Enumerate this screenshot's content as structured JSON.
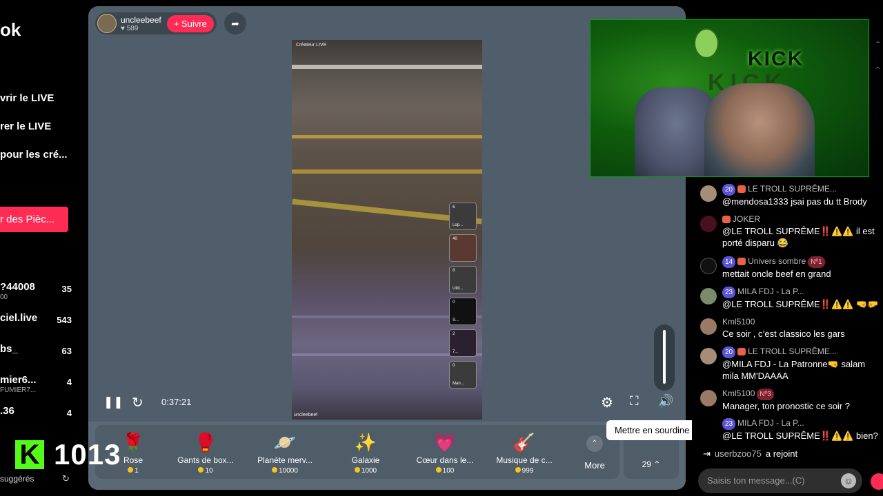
{
  "sidebar": {
    "logo": "ok",
    "menu": [
      "vrir le LIVE",
      "rer le LIVE",
      "pour les cré..."
    ],
    "coins_button": "r des Pièc...",
    "accounts": [
      {
        "name": "?44008",
        "sub": "00",
        "count": "35"
      },
      {
        "name": "ciel.live",
        "sub": "",
        "count": "543"
      },
      {
        "name": "bs_",
        "sub": "",
        "count": "63"
      },
      {
        "name": "mier6...",
        "sub": "FUMIER7...",
        "count": "4"
      },
      {
        "name": ".36",
        "sub": "",
        "count": "4"
      }
    ],
    "kick_count": "1013",
    "suggested": "suggérés"
  },
  "player": {
    "host_name": "uncleebeef",
    "host_likes": "589",
    "follow": "+ Suivre",
    "video_tag": "Créateur LIVE",
    "video_user": "uncleebeef",
    "time": "0:37:21",
    "thumbs": [
      {
        "n": "6",
        "label": "Lop..."
      },
      {
        "n": "40",
        "label": ""
      },
      {
        "n": "8",
        "label": "Utili..."
      },
      {
        "n": "0",
        "label": "S..."
      },
      {
        "n": "2",
        "label": "7..."
      },
      {
        "n": "0",
        "label": "Man..."
      }
    ],
    "tooltip": "Mettre en sourdine (M)"
  },
  "gifts": [
    {
      "name": "Rose",
      "price": "1",
      "icon": "🌹"
    },
    {
      "name": "Gants de box...",
      "price": "10",
      "icon": "🥊"
    },
    {
      "name": "Planète merv...",
      "price": "10000",
      "icon": "🪐"
    },
    {
      "name": "Galaxie",
      "price": "1000",
      "icon": "✨"
    },
    {
      "name": "Cœur dans le...",
      "price": "100",
      "icon": "💗"
    },
    {
      "name": "Musique de c...",
      "price": "999",
      "icon": "🎸"
    }
  ],
  "gift_more": "More",
  "box_count": "29",
  "cam": {
    "kick_text": "KICK",
    "kick_text2": "KICK"
  },
  "chat": {
    "messages": [
      {
        "level": "20",
        "user": "LE TROLL SUPRÊME...",
        "badge": "",
        "text": "@mendosa1333 jsai pas du tt Brody"
      },
      {
        "level": "",
        "user": "JOKER",
        "badge": "",
        "text": "@LE TROLL SUPRÊME‼️⚠️⚠️ il est porté disparu 😂"
      },
      {
        "level": "14",
        "user": "Univers sombre",
        "badge": "Nº1",
        "text": "mettait oncle beef en grand"
      },
      {
        "level": "23",
        "user": "MILA FDJ - La P...",
        "badge": "",
        "text": "@LE TROLL SUPRÊME‼️⚠️⚠️ 🤜🤛"
      },
      {
        "level": "",
        "user": "Kml5100",
        "badge": "",
        "text": "Ce soir , c’est classico les gars"
      },
      {
        "level": "20",
        "user": "LE TROLL SUPRÊME...",
        "badge": "",
        "text": "@MILA FDJ - La Patronne🤜 salam mila MM'DAAAA"
      },
      {
        "level": "",
        "user": "Kml5100",
        "badge": "Nº3",
        "text": "Manager, ton pronostic ce soir ?"
      },
      {
        "level": "23",
        "user": "MILA FDJ - La P...",
        "badge": "",
        "text": "@LE TROLL SUPRÊME‼️⚠️⚠️ bien?"
      }
    ],
    "joined_user": "userbzoo75",
    "joined_text": "a rejoint",
    "input_placeholder": "Saisis ton message...(C)"
  }
}
